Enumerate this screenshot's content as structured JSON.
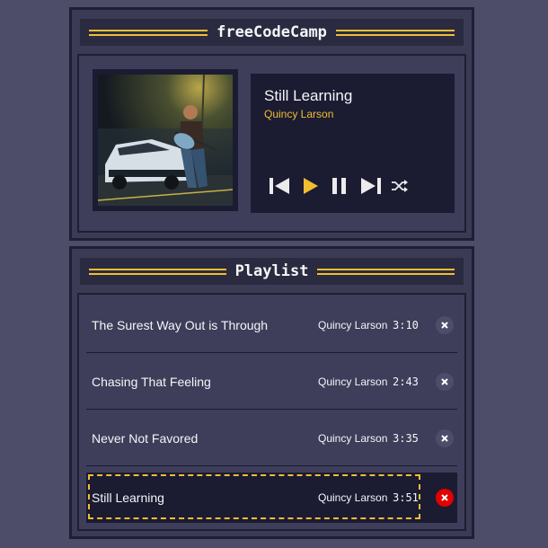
{
  "player": {
    "header_title": "freeCodeCamp",
    "current_track": {
      "title": "Still Learning",
      "artist": "Quincy Larson"
    },
    "controls": [
      "previous-icon",
      "play-icon",
      "pause-icon",
      "next-icon",
      "shuffle-icon"
    ]
  },
  "playlist": {
    "header_title": "Playlist",
    "songs": [
      {
        "title": "The Surest Way Out is Through",
        "artist": "Quincy Larson",
        "duration": "3:10",
        "active": false
      },
      {
        "title": "Chasing That Feeling",
        "artist": "Quincy Larson",
        "duration": "2:43",
        "active": false
      },
      {
        "title": "Never Not Favored",
        "artist": "Quincy Larson",
        "duration": "3:35",
        "active": false
      },
      {
        "title": "Still Learning",
        "artist": "Quincy Larson",
        "duration": "3:51",
        "active": true
      }
    ]
  },
  "colors": {
    "background": "#4d4d6a",
    "panel": "#3b3b55",
    "dark": "#1b1b32",
    "accent": "#f1be32",
    "text": "#f5f6f7",
    "delete_active": "#e20000"
  }
}
